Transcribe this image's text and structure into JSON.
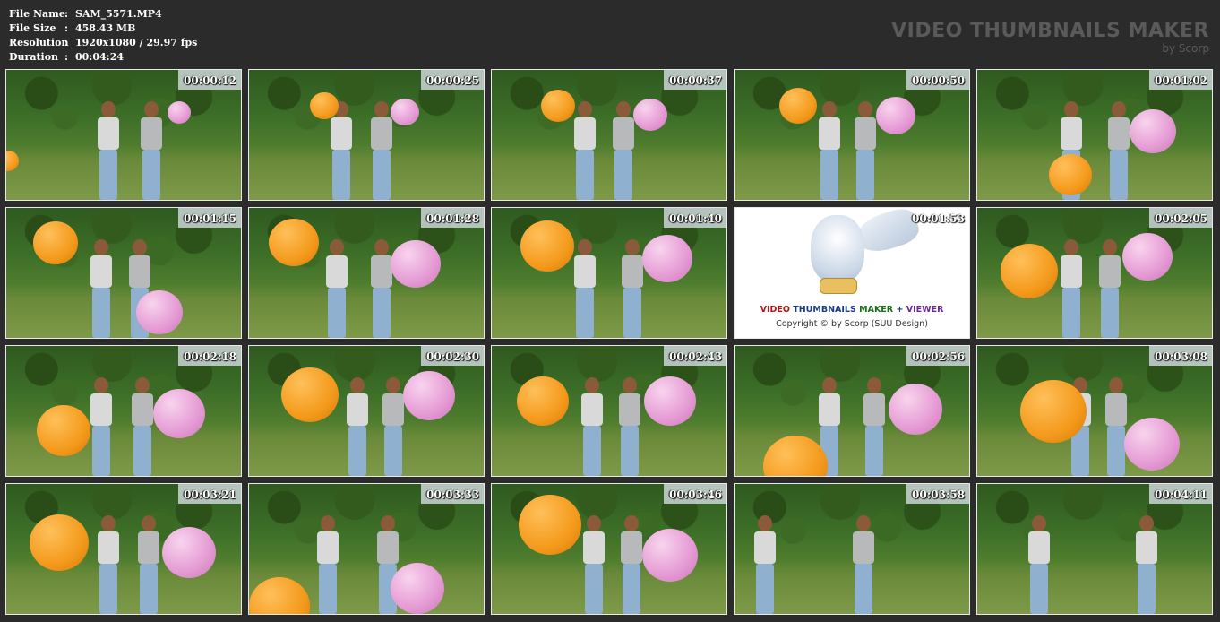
{
  "info": {
    "rows": [
      {
        "label": "File Name",
        "value": "SAM_5571.MP4"
      },
      {
        "label": "File Size",
        "value": "458.43 MB"
      },
      {
        "label": "Resolution",
        "value": "1920x1080 / 29.97 fps"
      },
      {
        "label": "Duration",
        "value": "00:04:24"
      }
    ]
  },
  "brand": {
    "title": "VIDEO THUMBNAILS MAKER",
    "subtitle": "by Scorp"
  },
  "thumbnails": [
    "00:00:12",
    "00:00:25",
    "00:00:37",
    "00:00:50",
    "00:01:02",
    "00:01:15",
    "00:01:28",
    "00:01:40",
    "00:01:53",
    "00:02:05",
    "00:02:18",
    "00:02:30",
    "00:02:43",
    "00:02:56",
    "00:03:08",
    "00:03:21",
    "00:03:33",
    "00:03:46",
    "00:03:58",
    "00:04:11"
  ],
  "logo": {
    "word1": "VIDEO",
    "word2": "THUMBNAILS",
    "word3": "MAKER",
    "plus": "+",
    "word4": "VIEWER",
    "copyright": "Copyright © by Scorp (SUU Design)"
  },
  "colors": {
    "background": "#2b2b2b",
    "orange_balloon": "#f49a1c",
    "pink_balloon": "#e59ad4"
  }
}
